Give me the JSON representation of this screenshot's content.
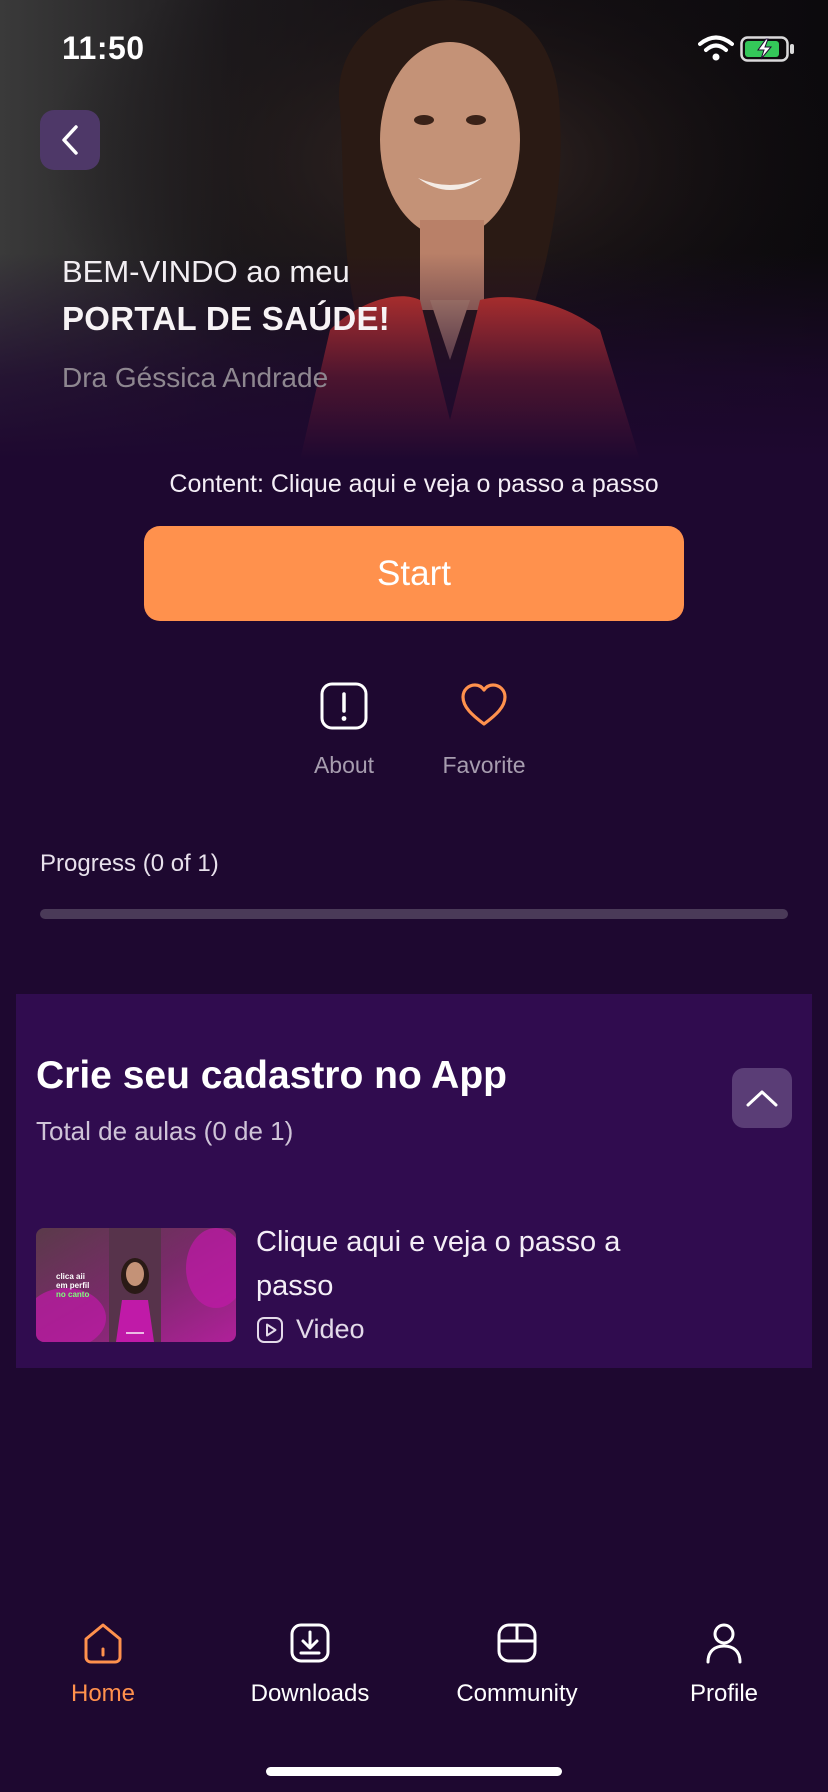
{
  "status_bar": {
    "time": "11:50"
  },
  "hero": {
    "line1": "BEM-VINDO ao meu",
    "line2": "PORTAL DE SAÚDE!",
    "line3": "Dra Géssica Andrade"
  },
  "content": {
    "caption": "Content: Clique aqui e veja o passo a passo",
    "start_label": "Start"
  },
  "actions": {
    "about_label": "About",
    "favorite_label": "Favorite"
  },
  "progress": {
    "label": "Progress (0 of 1)",
    "completed": 0,
    "total": 1
  },
  "module": {
    "title": "Crie seu cadastro no App",
    "subtitle": "Total de aulas (0 de 1)",
    "lessons": [
      {
        "title": "Clique aqui e veja o passo a passo",
        "type": "Video",
        "thumbnail_text": [
          "clica aii",
          "em perfil",
          "no canto"
        ]
      }
    ]
  },
  "bottom_nav": {
    "items": [
      {
        "label": "Home",
        "icon": "home-icon",
        "active": true
      },
      {
        "label": "Downloads",
        "icon": "download-icon",
        "active": false
      },
      {
        "label": "Community",
        "icon": "community-icon",
        "active": false
      },
      {
        "label": "Profile",
        "icon": "profile-icon",
        "active": false
      }
    ]
  },
  "colors": {
    "background": "#1e0830",
    "card": "#300c4f",
    "accent": "#ff914d",
    "back_button": "#4e3868"
  }
}
